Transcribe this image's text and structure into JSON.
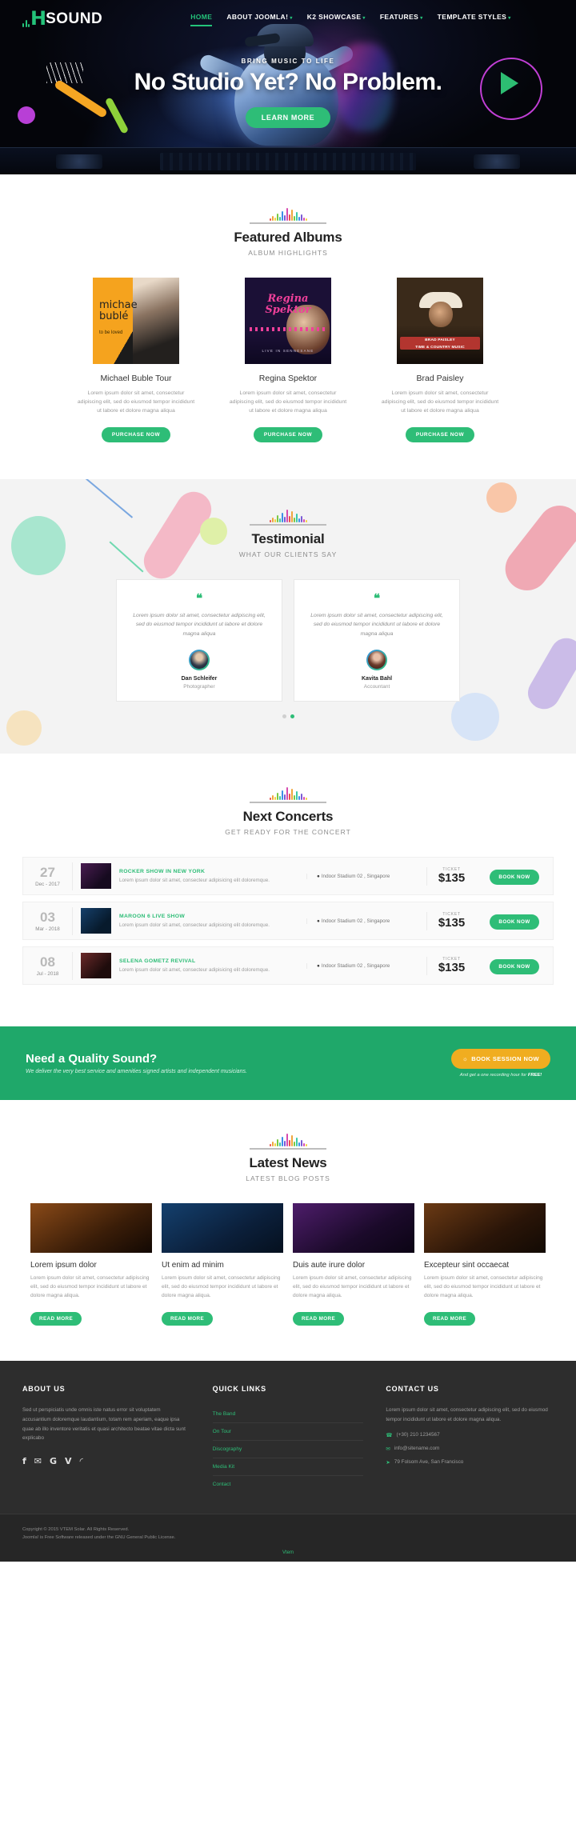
{
  "brand": {
    "logo_h": "H",
    "logo_text": "SOUND"
  },
  "nav": {
    "items": [
      {
        "label": "HOME",
        "caret": false,
        "active": true
      },
      {
        "label": "ABOUT JOOMLA!",
        "caret": true,
        "active": false
      },
      {
        "label": "K2 SHOWCASE",
        "caret": true,
        "active": false
      },
      {
        "label": "FEATURES",
        "caret": true,
        "active": false
      },
      {
        "label": "TEMPLATE STYLES",
        "caret": true,
        "active": false
      }
    ]
  },
  "hero": {
    "tagline": "BRING MUSIC TO LIFE",
    "title": "No Studio Yet? No Problem.",
    "button": "LEARN MORE"
  },
  "albums_section": {
    "title": "Featured Albums",
    "subtitle": "ALBUM HIGHLIGHTS",
    "items": [
      {
        "title": "Michael Buble Tour",
        "desc": "Lorem ipsum dolor sit amet, consectetur adipiscing elit, sed do eiusmod tempor incididunt ut labore et dolore magna aliqua",
        "button": "PURCHASE NOW",
        "cover_line1": "michae",
        "cover_line2": "bublé",
        "cover_sub": "to be loved"
      },
      {
        "title": "Regina Spektor",
        "desc": "Lorem ipsum dolor sit amet, consectetur adipiscing elit, sed do eiusmod tempor incididunt ut labore et dolore magna aliqua",
        "button": "PURCHASE NOW",
        "cover_line1": "Regina",
        "cover_line2": "Spektor",
        "cover_sub": "LIVE IN SENNESANE"
      },
      {
        "title": "Brad Paisley",
        "desc": "Lorem ipsum dolor sit amet, consectetur adipiscing elit, sed do eiusmod tempor incididunt ut labore et dolore magna aliqua",
        "button": "PURCHASE NOW",
        "cover_line1": "BRAD PAISLEY",
        "cover_line2": "TIME & COUNTRY MUSIC",
        "cover_sub": ""
      }
    ]
  },
  "testimonial_section": {
    "title": "Testimonial",
    "subtitle": "WHAT OUR CLIENTS SAY",
    "quote_glyph": "“",
    "items": [
      {
        "text": "Lorem ipsum dolor sit amet, consectetur adipiscing elit, sed do eiusmod tempor incididunt ut labore et dolore magna aliqua",
        "name": "Dan Schleifer",
        "role": "Photographer"
      },
      {
        "text": "Lorem ipsum dolor sit amet, consectetur adipiscing elit, sed do eiusmod tempor incididunt ut labore et dolore magna aliqua",
        "name": "Kavita Bahl",
        "role": "Accountant"
      }
    ]
  },
  "concerts_section": {
    "title": "Next Concerts",
    "subtitle": "GET READY FOR THE CONCERT",
    "ticket_label": "TICKET",
    "book_label": "BOOK NOW",
    "rows": [
      {
        "day": "27",
        "month": "Dec - 2017",
        "title": "ROCKER SHOW IN NEW YORK",
        "desc": "Lorem ipsum dolor sit amet, consecteur adipisicing elit doloremque.",
        "venue": "Indoor Stadium 02 , Singapore",
        "price": "$135"
      },
      {
        "day": "03",
        "month": "Mar - 2018",
        "title": "MAROON 6 LIVE SHOW",
        "desc": "Lorem ipsum dolor sit amet, consecteur adipisicing elit doloremque.",
        "venue": "Indoor Stadium 02 , Singapore",
        "price": "$135"
      },
      {
        "day": "08",
        "month": "Jul - 2018",
        "title": "SELENA GOMETZ REVIVAL",
        "desc": "Lorem ipsum dolor sit amet, consecteur adipisicing elit doloremque.",
        "venue": "Indoor Stadium 02 , Singapore",
        "price": "$135"
      }
    ]
  },
  "cta": {
    "title": "Need a Quality Sound?",
    "subtitle": "We deliver the very best service and amenities signed artists and independent musicians.",
    "button": "BOOK SESSION NOW",
    "note_prefix": "And get a one recording hour for ",
    "note_strong": "FREE!",
    "button_icon": "calendar-icon"
  },
  "news_section": {
    "title": "Latest News",
    "subtitle": "LATEST BLOG POSTS",
    "read_label": "READ MORE",
    "items": [
      {
        "title": "Lorem ipsum dolor",
        "desc": "Lorem ipsum dolor sit amet, consectetur adipiscing elit, sed do eiusmod tempor incididunt ut labore et dolore magna aliqua."
      },
      {
        "title": "Ut enim ad minim",
        "desc": "Lorem ipsum dolor sit amet, consectetur adipiscing elit, sed do eiusmod tempor incididunt ut labore et dolore magna aliqua."
      },
      {
        "title": "Duis aute irure dolor",
        "desc": "Lorem ipsum dolor sit amet, consectetur adipiscing elit, sed do eiusmod tempor incididunt ut labore et dolore magna aliqua."
      },
      {
        "title": "Excepteur sint occaecat",
        "desc": "Lorem ipsum dolor sit amet, consectetur adipiscing elit, sed do eiusmod tempor incididunt ut labore et dolore magna aliqua."
      }
    ]
  },
  "footer": {
    "about_title": "ABOUT US",
    "about_text": "Sed ut perspiciatis unde omnis iste natus error sit voluptatem accusantium doloremque laudantium, totam rem aperiam, eaque ipsa quae ab illo inventore veritatis et quasi architecto beatae vitae dicta sunt explicabo",
    "socials": [
      {
        "name": "facebook-icon",
        "glyph": "f"
      },
      {
        "name": "twitter-icon",
        "glyph": "✉"
      },
      {
        "name": "google-plus-icon",
        "glyph": "G"
      },
      {
        "name": "vimeo-icon",
        "glyph": "V"
      },
      {
        "name": "rss-icon",
        "glyph": "◜"
      }
    ],
    "links_title": "QUICK LINKS",
    "links": [
      "The Band",
      "On Tour",
      "Discography",
      "Media Kit",
      "Contact"
    ],
    "contact_title": "CONTACT US",
    "contact_text": "Lorem ipsum dolor sit amet, consectetur adipiscing elit, sed do eiusmod tempor incididunt ut labore et dolore magna aliqua.",
    "phone": "(+30) 210 1234567",
    "email": "info@sitename.com",
    "address": "79 Folsom Ave,  San Francisco",
    "phone_icon": "phone-icon",
    "email_icon": "envelope-icon",
    "address_icon": "location-pin-icon",
    "copyright_line1": "Copyright © 2015 VTEM Solar. All Rights Reserved.",
    "copyright_line2": "Joomla! is Free Software released under the GNU General Public License.",
    "vtem": "Vtem"
  },
  "colors": {
    "accent": "#2ebd77",
    "cta_bg": "#1fa86a",
    "cta_button": "#f0ad20",
    "footer_bg": "#2d2d2d"
  }
}
